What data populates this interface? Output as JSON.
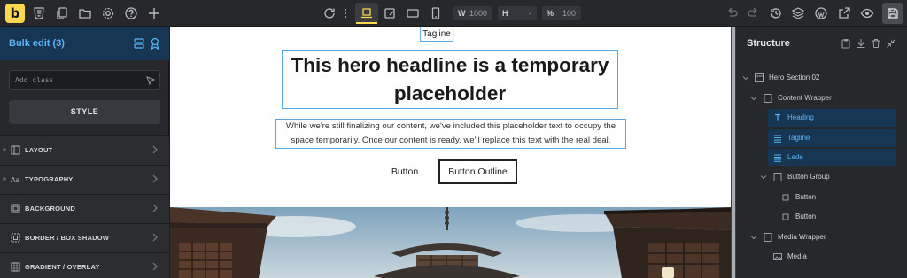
{
  "app": {
    "logo_letter": "b"
  },
  "toolbar": {
    "width_label": "W",
    "width_value": "1000",
    "height_label": "H",
    "height_value": "-",
    "scale_label": "%",
    "scale_value": "100"
  },
  "left_panel": {
    "title": "Bulk edit (3)",
    "class_placeholder": "Add class",
    "style_button": "STYLE",
    "sections": [
      {
        "label": "LAYOUT",
        "icon": "layout-icon"
      },
      {
        "label": "TYPOGRAPHY",
        "icon": "typography-icon"
      },
      {
        "label": "BACKGROUND",
        "icon": "background-icon"
      },
      {
        "label": "BORDER / BOX SHADOW",
        "icon": "border-icon"
      },
      {
        "label": "GRADIENT / OVERLAY",
        "icon": "gradient-icon"
      }
    ]
  },
  "canvas": {
    "tagline": "Tagline",
    "heading": "This hero headline is a temporary placeholder",
    "lede": "While we're still finalizing our content, we've included this placeholder text to occupy the space temporarily. Once our content is ready, we'll replace this text with the real deal.",
    "button": "Button",
    "button_outline": "Button Outline"
  },
  "structure": {
    "title": "Structure",
    "nodes": [
      {
        "label": "Hero Section 02",
        "icon": "section-icon"
      },
      {
        "label": "Content Wrapper",
        "icon": "container-icon"
      },
      {
        "label": "Heading",
        "icon": "heading-icon",
        "selected": true
      },
      {
        "label": "Tagline",
        "icon": "text-icon",
        "selected": true
      },
      {
        "label": "Lede",
        "icon": "text-icon",
        "selected": true
      },
      {
        "label": "Button Group",
        "icon": "container-icon"
      },
      {
        "label": "Button",
        "icon": "button-icon"
      },
      {
        "label": "Button",
        "icon": "button-icon"
      },
      {
        "label": "Media Wrapper",
        "icon": "container-icon"
      },
      {
        "label": "Media",
        "icon": "image-icon"
      }
    ]
  },
  "colors": {
    "accent": "#ffd64f",
    "selection": "#59b5f7",
    "selected_bg": "#173653"
  }
}
